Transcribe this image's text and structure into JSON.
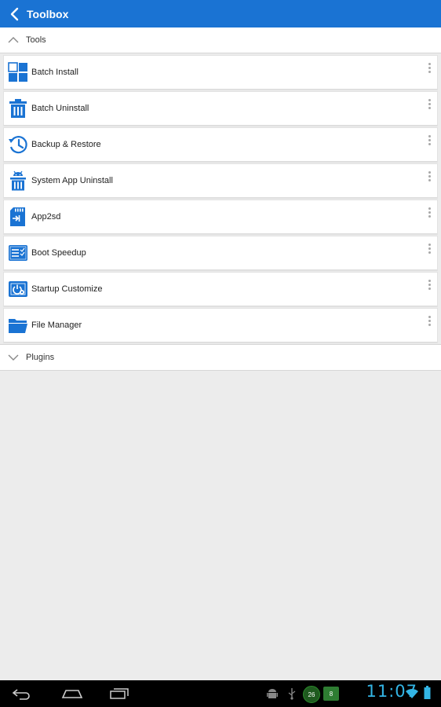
{
  "appbar": {
    "title": "Toolbox"
  },
  "tools_section": {
    "label": "Tools"
  },
  "plugins_section": {
    "label": "Plugins"
  },
  "items": [
    {
      "label": "Batch Install",
      "icon": "batch-install-icon"
    },
    {
      "label": "Batch Uninstall",
      "icon": "trash-icon"
    },
    {
      "label": "Backup & Restore",
      "icon": "history-icon"
    },
    {
      "label": "System App Uninstall",
      "icon": "android-trash-icon"
    },
    {
      "label": "App2sd",
      "icon": "sd-card-icon"
    },
    {
      "label": "Boot Speedup",
      "icon": "boot-speedup-icon"
    },
    {
      "label": "Startup Customize",
      "icon": "startup-customize-icon"
    },
    {
      "label": "File Manager",
      "icon": "folder-icon"
    }
  ],
  "statusbar": {
    "time": "11:07",
    "badge_count": "26",
    "sim_label": "8"
  },
  "colors": {
    "accent": "#1a73d3",
    "clock": "#33b5e5"
  }
}
